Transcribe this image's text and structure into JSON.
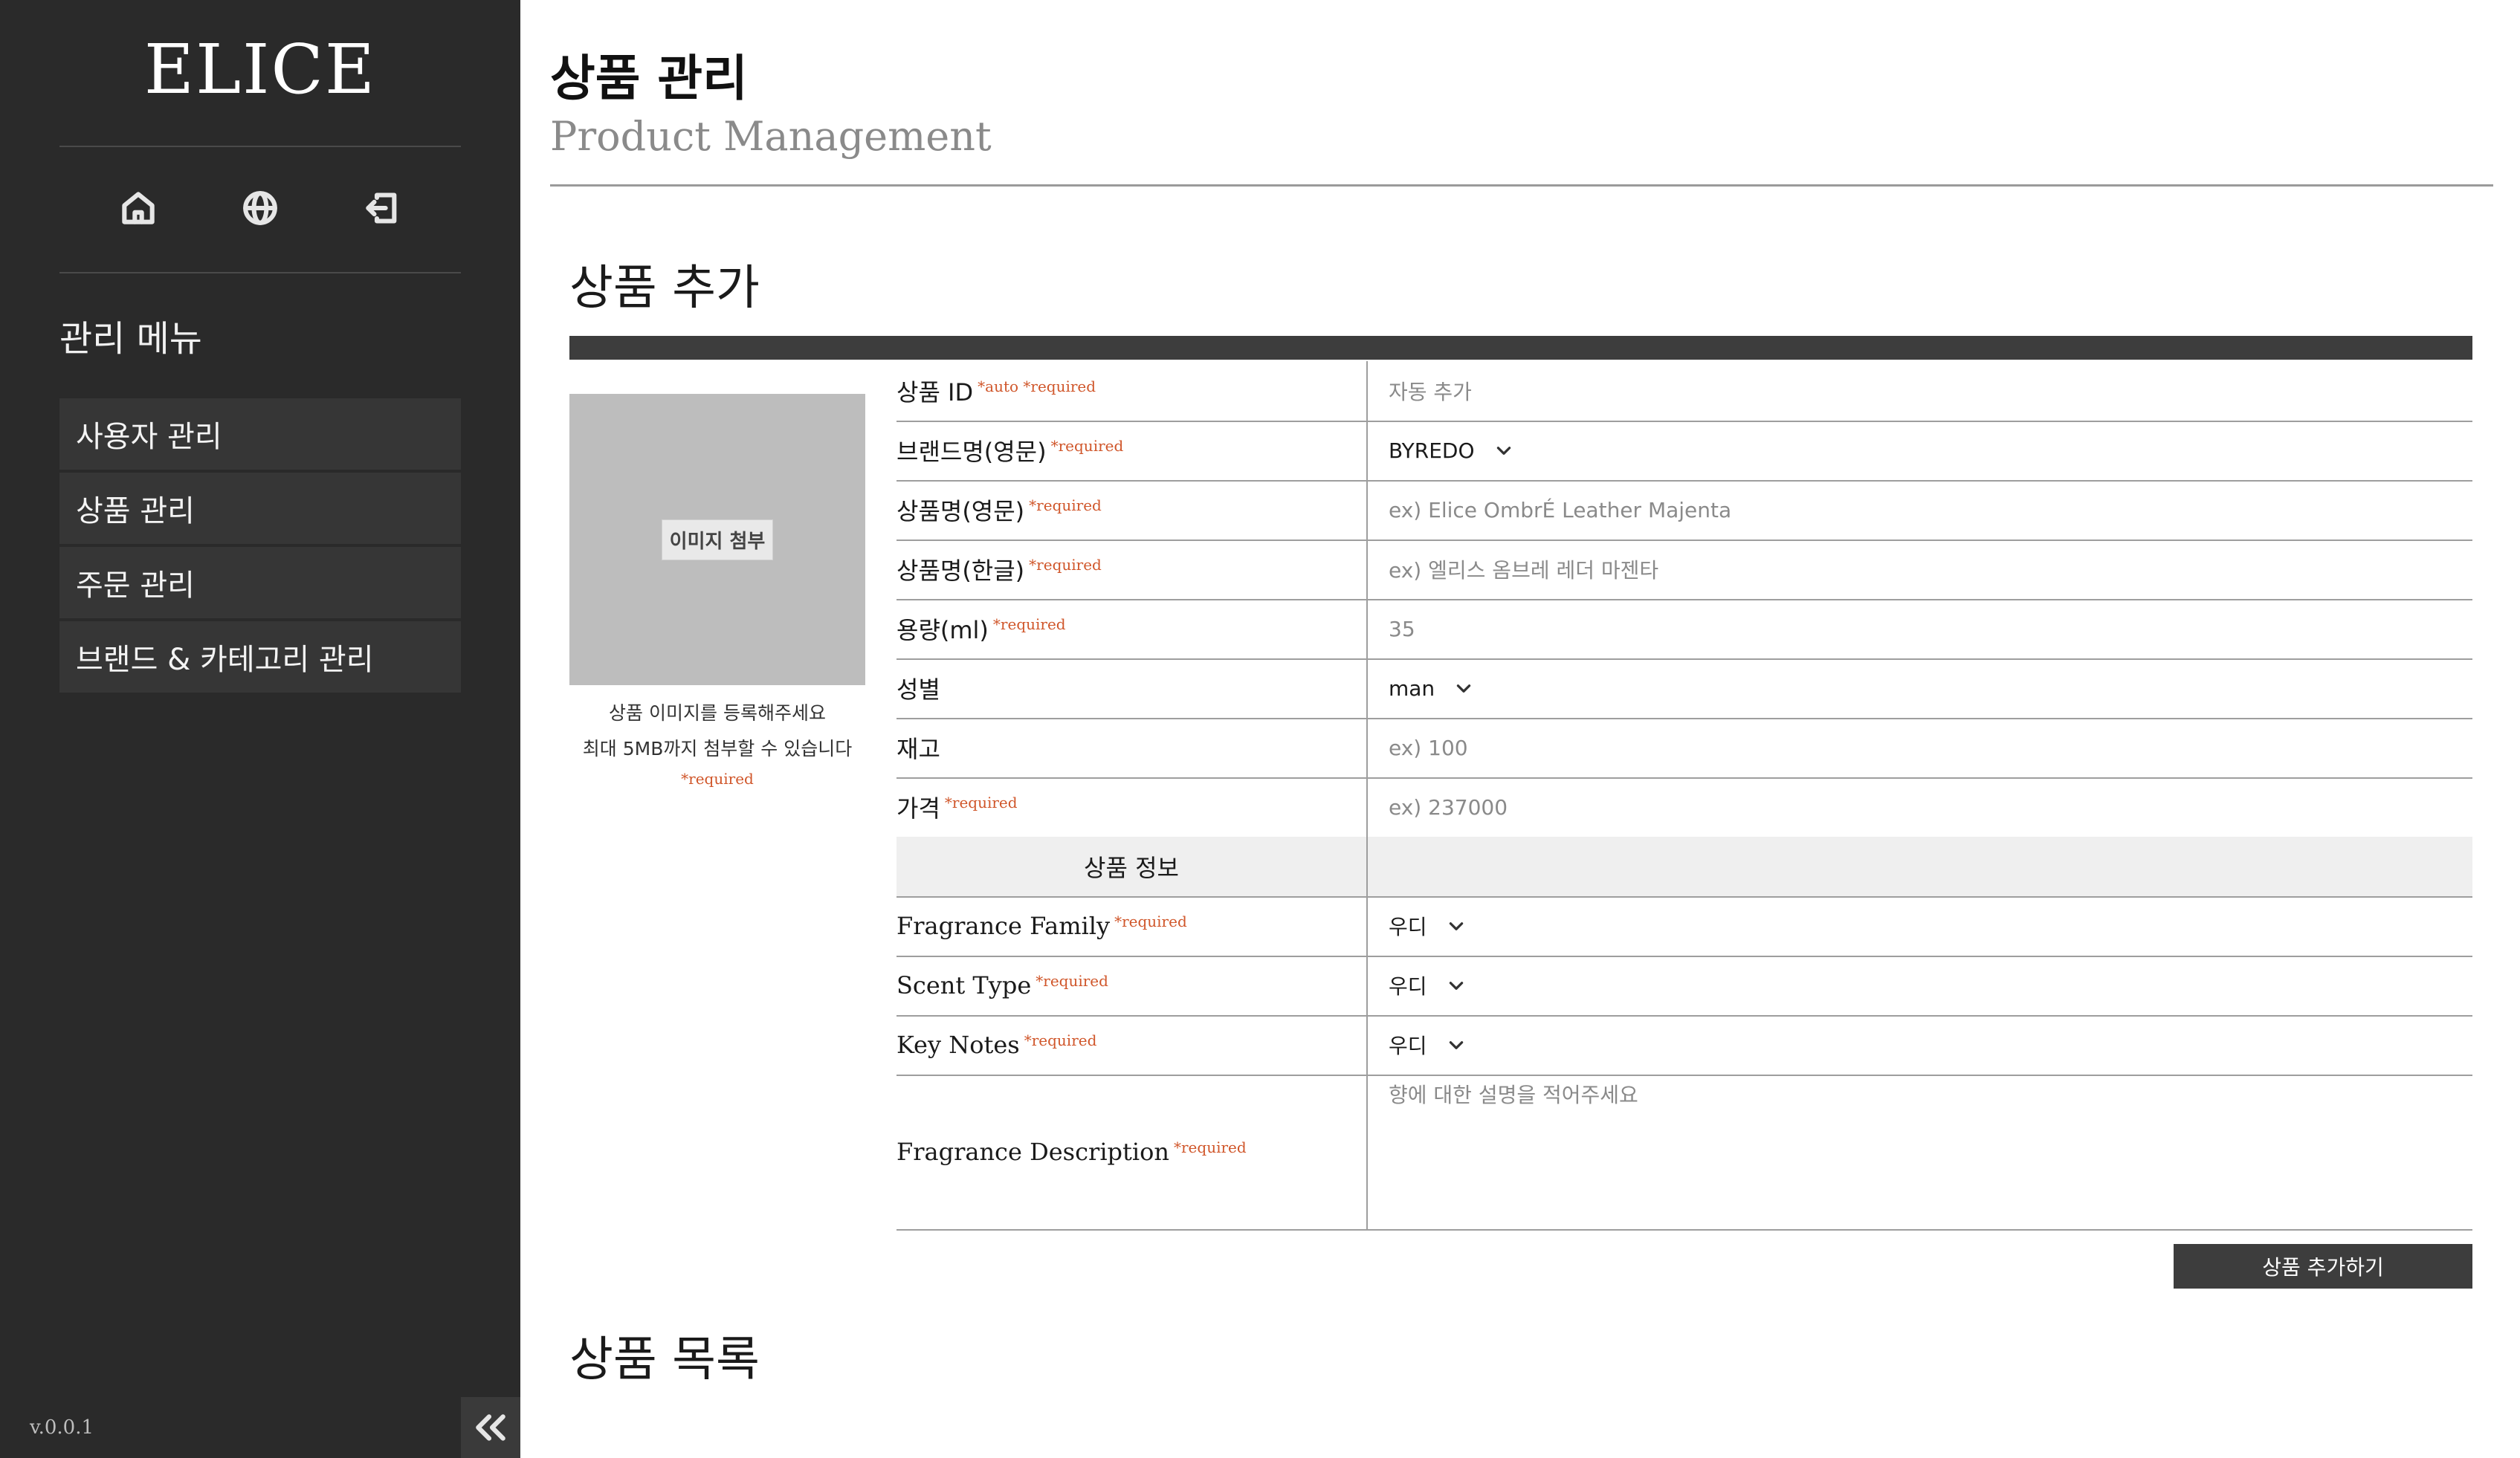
{
  "app": {
    "logo": "ELICE",
    "version": "v.0.0.1"
  },
  "sidebar": {
    "icons": [
      "home-icon",
      "globe-icon",
      "logout-icon"
    ],
    "menu_heading": "관리 메뉴",
    "items": [
      {
        "label": "사용자 관리"
      },
      {
        "label": "상품 관리"
      },
      {
        "label": "주문 관리"
      },
      {
        "label": "브랜드 & 카테고리 관리"
      }
    ]
  },
  "header": {
    "title": "상품 관리",
    "subtitle": "Product Management"
  },
  "add_section": {
    "title": "상품 추가",
    "image": {
      "button": "이미지 첨부",
      "caption_line1": "상품 이미지를 등록해주세요",
      "caption_line2": "최대 5MB까지 첨부할 수 있습니다",
      "required": "*required"
    },
    "rows": [
      {
        "label": "상품 ID",
        "tags": "*auto *required",
        "value": "자동 추가"
      },
      {
        "label": "브랜드명(영문)",
        "tags": "*required",
        "value": "BYREDO"
      },
      {
        "label": "상품명(영문)",
        "tags": "*required",
        "placeholder": "ex) Elice OmbrÉ Leather Majenta"
      },
      {
        "label": "상품명(한글)",
        "tags": "*required",
        "placeholder": "ex) 엘리스 옴브레 레더 마젠타"
      },
      {
        "label": "용량(ml)",
        "tags": "*required",
        "placeholder": "35"
      },
      {
        "label": "성별",
        "tags": "",
        "value": "man"
      },
      {
        "label": "재고",
        "tags": "",
        "placeholder": "ex) 100"
      },
      {
        "label": "가격",
        "tags": "*required",
        "placeholder": "ex) 237000"
      }
    ],
    "info_header": "상품 정보",
    "info_rows": [
      {
        "label": "Fragrance Family",
        "tags": "*required",
        "value": "우디"
      },
      {
        "label": "Scent Type",
        "tags": "*required",
        "value": "우디"
      },
      {
        "label": "Key Notes",
        "tags": "*required",
        "value": "우디"
      }
    ],
    "description": {
      "label": "Fragrance Description",
      "tags": "*required",
      "placeholder": "향에 대한 설명을 적어주세요"
    },
    "submit": "상품 추가하기"
  },
  "list_section": {
    "title": "상품 목록"
  },
  "colors": {
    "sidebar_bg": "#2a2a2a",
    "required": "#d0562a",
    "dark_button": "#3d3d3d"
  }
}
